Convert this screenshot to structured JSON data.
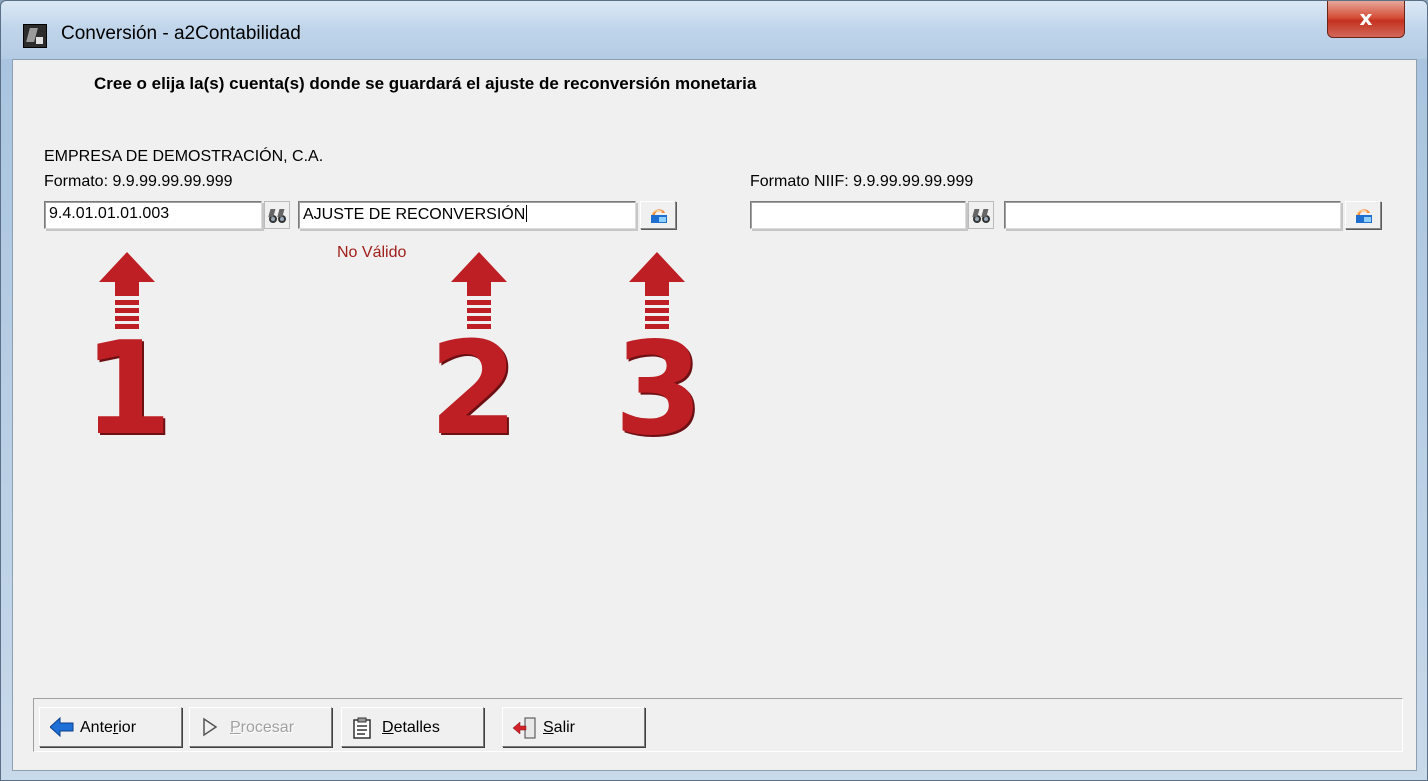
{
  "window": {
    "title": "Conversión - a2Contabilidad",
    "close_label": "x"
  },
  "main": {
    "heading": "Cree o elija la(s) cuenta(s) donde se guardará el ajuste de reconversión monetaria",
    "company": "EMPRESA DE DEMOSTRACIÓN, C.A.",
    "left_panel": {
      "format_label": "Formato: 9.9.99.99.99.999",
      "account_code": "9.4.01.01.01.003",
      "account_name": "AJUSTE DE RECONVERSIÓN",
      "validation_message": "No Válido"
    },
    "right_panel": {
      "format_label": "Formato NIIF: 9.9.99.99.99.999",
      "account_code": "",
      "account_name": ""
    },
    "annotations": [
      "1",
      "2",
      "3"
    ],
    "annotation_color": "#bd1f24"
  },
  "buttons": {
    "previous": {
      "pre": "Ante",
      "key": "r",
      "post": "ior"
    },
    "process": {
      "pre": "",
      "key": "P",
      "post": "rocesar",
      "disabled": true
    },
    "details": {
      "pre": "",
      "key": "D",
      "post": "etalles"
    },
    "exit": {
      "pre": "",
      "key": "S",
      "post": "alir"
    }
  }
}
